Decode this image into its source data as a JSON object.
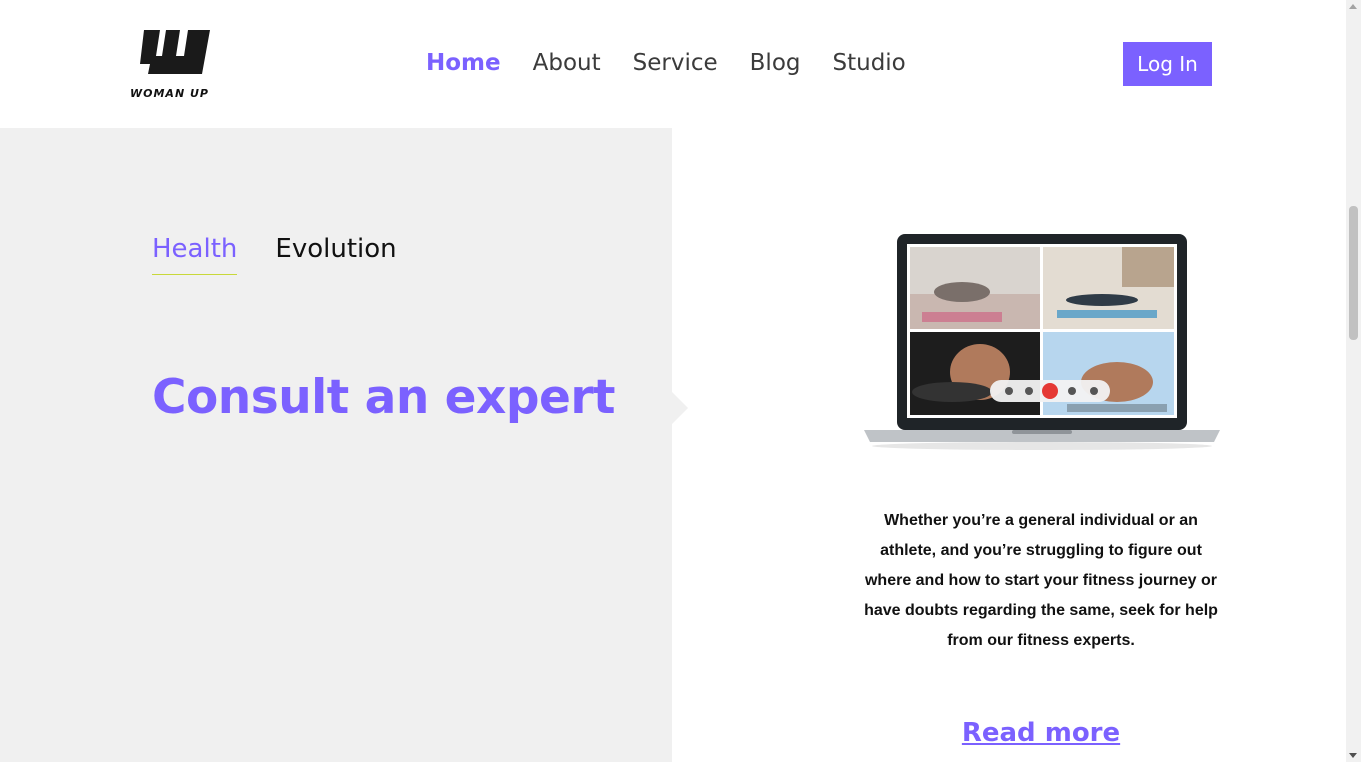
{
  "brand": {
    "name": "WOMAN UP"
  },
  "nav": {
    "items": [
      {
        "label": "Home",
        "active": true
      },
      {
        "label": "About",
        "active": false
      },
      {
        "label": "Service",
        "active": false
      },
      {
        "label": "Blog",
        "active": false
      },
      {
        "label": "Studio",
        "active": false
      }
    ],
    "login_label": "Log In"
  },
  "tabs": [
    {
      "label": "Health",
      "active": true
    },
    {
      "label": "Evolution",
      "active": false
    }
  ],
  "headline": "Consult an expert",
  "description": "Whether you’re a general individual or an athlete, and you’re struggling to figure out where and how to start your fitness journey or have doubts regarding the same, seek for help from our fitness experts.",
  "read_more": "Read more",
  "colors": {
    "accent": "#7b61ff",
    "panel": "#f0f0f0",
    "tab_underline": "#c8d83a",
    "call_end": "#e53935"
  }
}
